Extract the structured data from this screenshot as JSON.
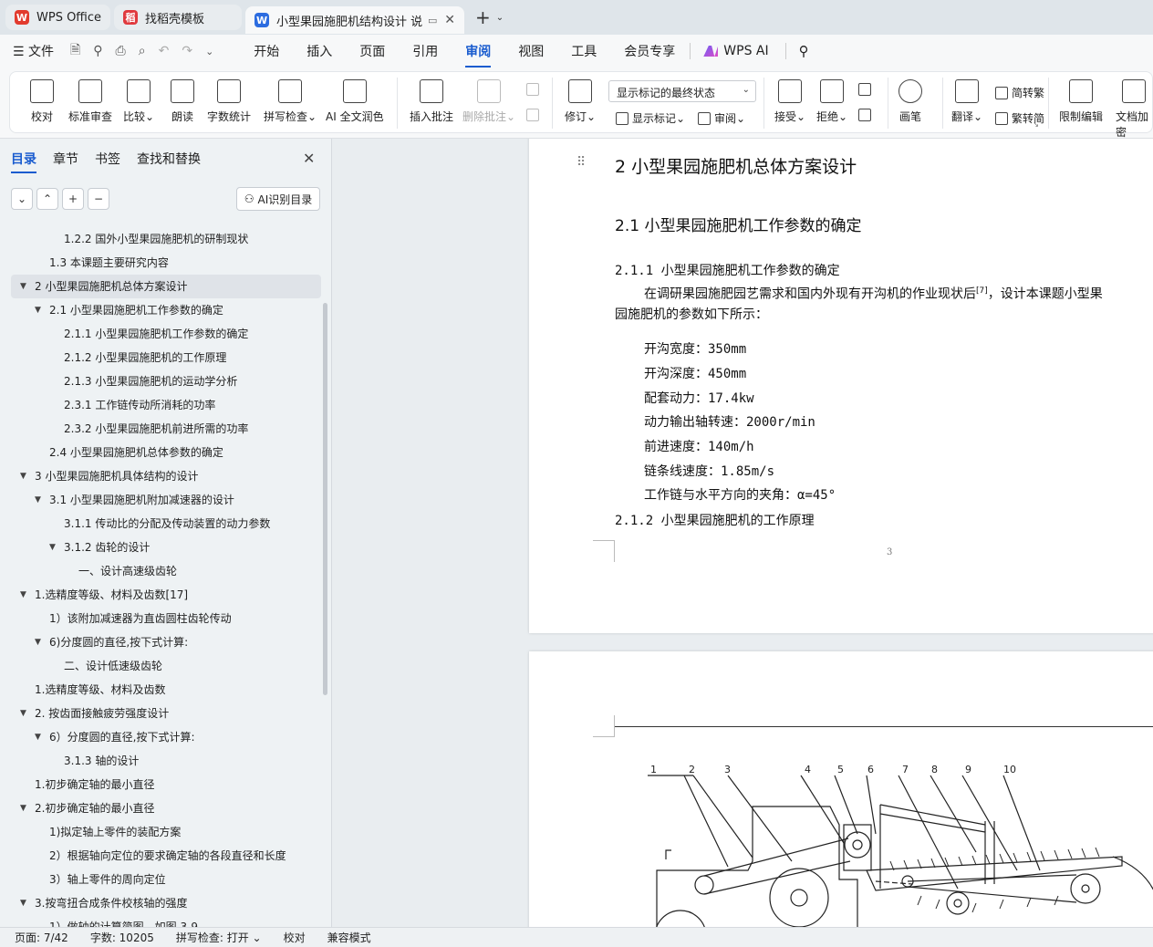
{
  "tabs": [
    {
      "label": "WPS Office",
      "icon": "wps-logo-icon",
      "color": "#e23b2e"
    },
    {
      "label": "找稻壳模板",
      "icon": "docer-icon",
      "color": "#e0393e"
    },
    {
      "label": "小型果园施肥机结构设计 说明",
      "icon": "writer-doc-icon",
      "color": "#2c6ce0"
    }
  ],
  "menu": {
    "file": "文件",
    "items": [
      "开始",
      "插入",
      "页面",
      "引用",
      "审阅",
      "视图",
      "工具",
      "会员专享"
    ],
    "active": "审阅",
    "wps_ai": "WPS AI"
  },
  "ribbon": {
    "proofread": "校对",
    "standard_review": "标准审查",
    "compare": "比较",
    "read_aloud": "朗读",
    "word_count": "字数统计",
    "spell_check": "拼写检查",
    "ai_proofread": "AI 全文润色",
    "insert_comment": "插入批注",
    "delete_comment": "删除批注",
    "revise": "修订",
    "show_markup_mode": "显示标记的最终状态",
    "show_markup": "显示标记",
    "review": "审阅",
    "accept": "接受",
    "reject": "拒绝",
    "pen": "画笔",
    "translate": "翻译",
    "to_traditional": "简转繁",
    "to_simplified": "繁转简",
    "restrict_edit": "限制编辑",
    "doc_encrypt": "文档加密"
  },
  "sidepanel": {
    "tabs": [
      "目录",
      "章节",
      "书签",
      "查找和替换"
    ],
    "ai_toc": "AI识别目录",
    "toc": [
      {
        "text": "1.2.2 国外小型果园施肥机的研制现状",
        "level": 3,
        "caret": ""
      },
      {
        "text": "1.3 本课题主要研究内容",
        "level": 2,
        "caret": ""
      },
      {
        "text": "2 小型果园施肥机总体方案设计",
        "level": 1,
        "caret": "down",
        "selected": true
      },
      {
        "text": "2.1 小型果园施肥机工作参数的确定",
        "level": 2,
        "caret": "down"
      },
      {
        "text": "2.1.1 小型果园施肥机工作参数的确定",
        "level": 3,
        "caret": ""
      },
      {
        "text": "2.1.2 小型果园施肥机的工作原理",
        "level": 3,
        "caret": ""
      },
      {
        "text": "2.1.3 小型果园施肥机的运动学分析",
        "level": 3,
        "caret": ""
      },
      {
        "text": "2.3.1 工作链传动所消耗的功率",
        "level": 3,
        "caret": ""
      },
      {
        "text": "2.3.2 小型果园施肥机前进所需的功率",
        "level": 3,
        "caret": ""
      },
      {
        "text": "2.4 小型果园施肥机总体参数的确定",
        "level": 2,
        "caret": ""
      },
      {
        "text": "3  小型果园施肥机具体结构的设计",
        "level": 1,
        "caret": "down"
      },
      {
        "text": "3.1 小型果园施肥机附加减速器的设计",
        "level": 2,
        "caret": "down"
      },
      {
        "text": "3.1.1 传动比的分配及传动装置的动力参数",
        "level": 3,
        "caret": ""
      },
      {
        "text": "3.1.2 齿轮的设计",
        "level": 3,
        "caret": "down"
      },
      {
        "text": "一、设计高速级齿轮",
        "level": 4,
        "caret": ""
      },
      {
        "text": "1.选精度等级、材料及齿数[17]",
        "level": 1,
        "caret": "down"
      },
      {
        "text": "1）该附加减速器为直齿圆柱齿轮传动",
        "level": 2,
        "caret": ""
      },
      {
        "text": "6)分度圆的直径,按下式计算:",
        "level": 2,
        "caret": "down"
      },
      {
        "text": "二、设计低速级齿轮",
        "level": 3,
        "caret": ""
      },
      {
        "text": "1.选精度等级、材料及齿数",
        "level": 1,
        "caret": ""
      },
      {
        "text": "2. 按齿面接触疲劳强度设计",
        "level": 1,
        "caret": "down"
      },
      {
        "text": "6）分度圆的直径,按下式计算:",
        "level": 2,
        "caret": "down"
      },
      {
        "text": "3.1.3 轴的设计",
        "level": 3,
        "caret": ""
      },
      {
        "text": "1.初步确定轴的最小直径",
        "level": 1,
        "caret": ""
      },
      {
        "text": "2.初步确定轴的最小直径",
        "level": 1,
        "caret": "down"
      },
      {
        "text": "1)拟定轴上零件的装配方案",
        "level": 2,
        "caret": ""
      },
      {
        "text": "2）根据轴向定位的要求确定轴的各段直径和长度",
        "level": 2,
        "caret": ""
      },
      {
        "text": "3）轴上零件的周向定位",
        "level": 2,
        "caret": ""
      },
      {
        "text": "3.按弯扭合成条件校核轴的强度",
        "level": 1,
        "caret": "down"
      },
      {
        "text": "1）做轴的计算简图，如图 3-9",
        "level": 2,
        "caret": ""
      }
    ]
  },
  "document": {
    "h1": "2 小型果园施肥机总体方案设计",
    "h2": "2.1 小型果园施肥机工作参数的确定",
    "h3a": "2.1.1 小型果园施肥机工作参数的确定",
    "para1": "在调研果园施肥园艺需求和国内外现有开沟机的作业现状后",
    "para1_ref": "[7]",
    "para1_tail": "，设计本课题小型果",
    "para2": "园施肥机的参数如下所示：",
    "params": [
      "开沟宽度：350mm",
      "开沟深度：450mm",
      "配套动力：17.4kw",
      "动力输出轴转速：2000r/min",
      "前进速度：140m/h",
      "链条线速度：1.85m/s",
      "工作链与水平方向的夹角：α=45°"
    ],
    "h3b": "2.1.2 小型果园施肥机的工作原理",
    "page_number": "3",
    "figure_labels": [
      "1",
      "2",
      "3",
      "4",
      "5",
      "6",
      "7",
      "8",
      "9",
      "10"
    ]
  },
  "status": {
    "page": "页面: 7/42",
    "words": "字数: 10205",
    "spell": "拼写检查: 打开",
    "proof": "校对",
    "compat": "兼容模式"
  }
}
